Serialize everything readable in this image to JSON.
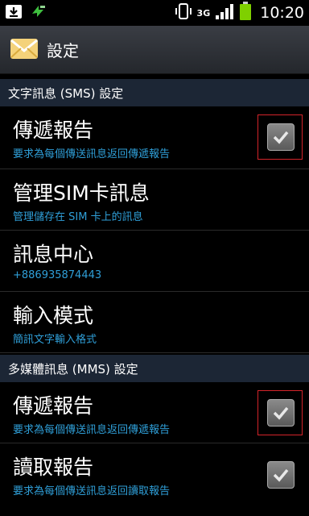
{
  "status": {
    "network": "3G",
    "time": "10:20"
  },
  "header": {
    "title": "設定"
  },
  "sections": [
    {
      "title": "文字訊息 (SMS) 設定"
    },
    {
      "title": "多媒體訊息 (MMS) 設定"
    }
  ],
  "sms_items": [
    {
      "title": "傳遞報告",
      "summary": "要求為每個傳送訊息返回傳遞報告",
      "checked": true
    },
    {
      "title": "管理SIM卡訊息",
      "summary": "管理儲存在 SIM 卡上的訊息"
    },
    {
      "title": "訊息中心",
      "summary": "+886935874443"
    },
    {
      "title": "輸入模式",
      "summary": "簡訊文字輸入格式"
    }
  ],
  "mms_items": [
    {
      "title": "傳遞報告",
      "summary": "要求為每個傳送訊息返回傳遞報告",
      "checked": true
    },
    {
      "title": "讀取報告",
      "summary": "要求為每個傳送訊息返回讀取報告",
      "checked": true
    }
  ],
  "icons": {
    "status_left": [
      "download-icon",
      "sync-icon"
    ],
    "status_right": [
      "vibrate-icon",
      "signal-icon",
      "battery-icon"
    ],
    "app": "messaging-envelope-icon",
    "checkbox": "checkmark-icon"
  },
  "colors": {
    "summary_text": "#2f9fd8",
    "highlight": "#d4242a",
    "section_bg": "#1c2635"
  }
}
